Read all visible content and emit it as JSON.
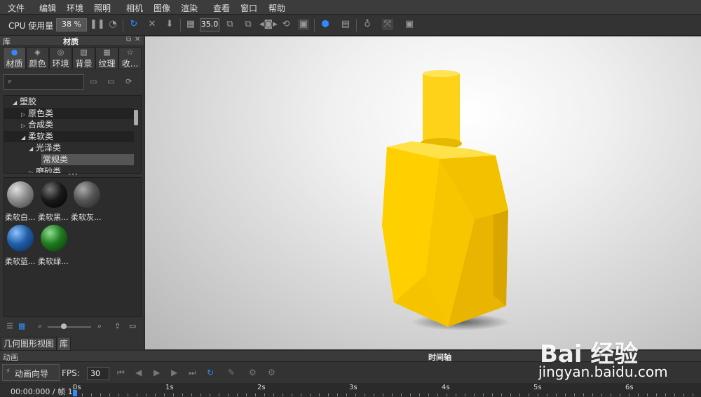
{
  "menu": [
    "文件",
    "编辑",
    "环境",
    "照明",
    "相机",
    "图像",
    "渲染",
    "查看",
    "窗口",
    "帮助"
  ],
  "toolbar": {
    "cpu_label": "CPU 使用量",
    "cpu_value": "38 %",
    "focal_value": "35.0"
  },
  "left_panel": {
    "header_left": "库",
    "header_title": "材质",
    "tabs": [
      {
        "label": "材质",
        "icon": "material-icon"
      },
      {
        "label": "颜色",
        "icon": "color-icon"
      },
      {
        "label": "环境",
        "icon": "environment-icon"
      },
      {
        "label": "背景",
        "icon": "background-icon"
      },
      {
        "label": "纹理",
        "icon": "texture-icon"
      },
      {
        "label": "收...",
        "icon": "favorites-icon"
      }
    ],
    "tree": [
      {
        "label": "塑胶",
        "arrow": "◢"
      },
      {
        "label": "原色类",
        "arrow": "▷"
      },
      {
        "label": "合成类",
        "arrow": "▷"
      },
      {
        "label": "柔软类",
        "arrow": "◢"
      },
      {
        "label": "光泽类",
        "arrow": "◢"
      },
      {
        "label": "常规类",
        "arrow": ""
      },
      {
        "label": "磨砂类",
        "arrow": "▷"
      }
    ],
    "swatches": [
      {
        "label": "柔软白...",
        "color": "#9a9a9a"
      },
      {
        "label": "柔软黑...",
        "color": "#1a1a1a"
      },
      {
        "label": "柔软灰...",
        "color": "#555555"
      },
      {
        "label": "柔软蓝...",
        "color": "#1f5fa8"
      },
      {
        "label": "柔软绿...",
        "color": "#1e7a1e"
      }
    ],
    "bottom_tabs": [
      "几何图形视图",
      "库"
    ]
  },
  "viewport": {
    "object_color": "#ffd000"
  },
  "animation": {
    "header_left": "动画",
    "header_title": "时间轴",
    "wizard_label": "动画向导",
    "fps_label": "FPS:",
    "fps_value": "30",
    "time_readout": "00:00:000 / 帧 1",
    "ticks": [
      "0s",
      "1s",
      "2s",
      "3s",
      "4s",
      "5s",
      "6s"
    ]
  },
  "watermark": {
    "logo": "Bai 经验",
    "url": "jingyan.baidu.com"
  }
}
